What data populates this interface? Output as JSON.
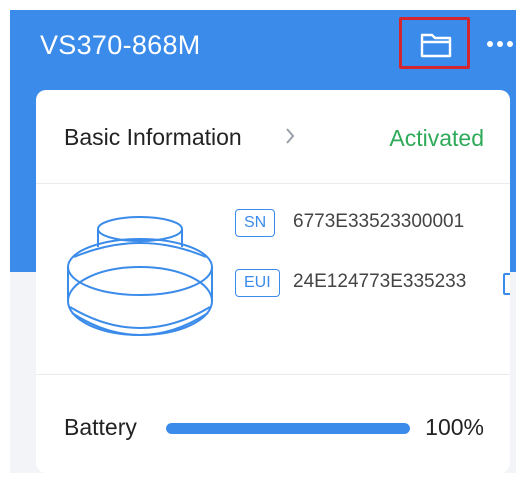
{
  "header": {
    "title": "VS370-868M",
    "folder_icon": "folder-icon",
    "more_icon": "more-dots-icon"
  },
  "card": {
    "basic_info_label": "Basic Information",
    "status": "Activated",
    "sn": {
      "badge": "SN",
      "value": "6773E33523300001"
    },
    "eui": {
      "badge": "EUI",
      "value": "24E124773E335233"
    },
    "battery": {
      "label": "Battery",
      "percent_text": "100%",
      "level": 1.0
    }
  },
  "colors": {
    "accent": "#3b8bea",
    "status_green": "#2eaa58",
    "highlight_red": "#d3262e"
  }
}
